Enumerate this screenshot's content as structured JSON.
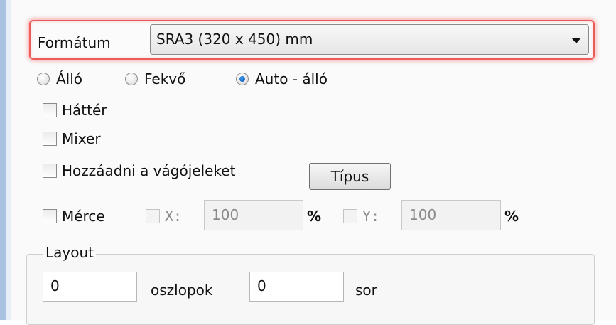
{
  "format": {
    "label": "Formátum",
    "selected": "SRA3 (320 x 450) mm"
  },
  "orientation": {
    "options": [
      {
        "label": "Álló",
        "checked": false
      },
      {
        "label": "Fekvő",
        "checked": false
      },
      {
        "label": "Auto - álló",
        "checked": true
      }
    ]
  },
  "options": {
    "background": "Háttér",
    "mixer": "Mixer",
    "crop_marks": "Hozzáadni a vágójeleket",
    "type_button": "Típus"
  },
  "scale": {
    "label": "Mérce",
    "x_label": "X:",
    "x_value": "100",
    "y_label": "Y:",
    "y_value": "100",
    "unit": "%"
  },
  "layout": {
    "title": "Layout",
    "columns_value": "0",
    "columns_label": "oszlopok",
    "rows_value": "0",
    "rows_label": "sor"
  },
  "colors": {
    "focus_glow": "#ec5a5a",
    "radio_accent": "#0a4fa6"
  }
}
